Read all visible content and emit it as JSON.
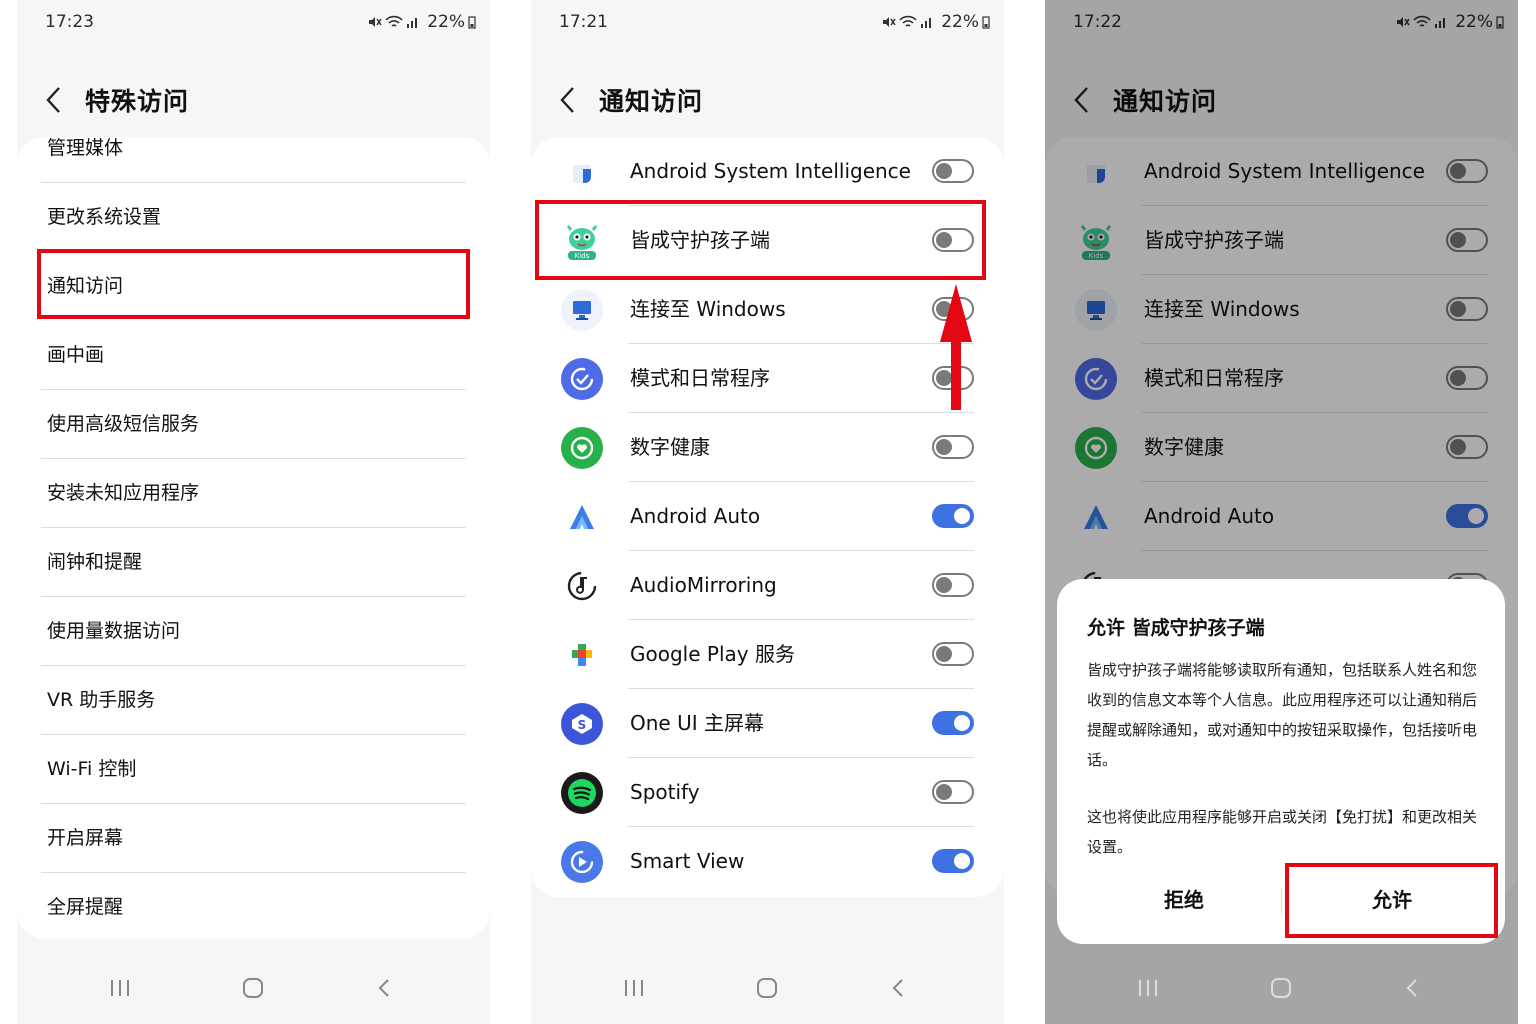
{
  "status": {
    "panel1_time": "17:23",
    "panel2_time": "17:21",
    "panel3_time": "17:22",
    "battery": "22%"
  },
  "panel1": {
    "title": "特殊访问",
    "items": [
      "管理媒体",
      "更改系统设置",
      "通知访问",
      "画中画",
      "使用高级短信服务",
      "安装未知应用程序",
      "闹钟和提醒",
      "使用量数据访问",
      "VR 助手服务",
      "Wi-Fi 控制",
      "开启屏幕",
      "全屏提醒"
    ]
  },
  "panel2": {
    "title": "通知访问",
    "apps": [
      {
        "label": "Android System Intelligence",
        "icon": "asi-icon",
        "enabled": false
      },
      {
        "label": "皆成守护孩子端",
        "icon": "kids-icon",
        "enabled": false
      },
      {
        "label": "连接至 Windows",
        "icon": "windows-link-icon",
        "enabled": false
      },
      {
        "label": "模式和日常程序",
        "icon": "modes-routines-icon",
        "enabled": false
      },
      {
        "label": "数字健康",
        "icon": "digital-wellbeing-icon",
        "enabled": false
      },
      {
        "label": "Android Auto",
        "icon": "android-auto-icon",
        "enabled": true
      },
      {
        "label": "AudioMirroring",
        "icon": "audio-mirroring-icon",
        "enabled": false
      },
      {
        "label": "Google Play 服务",
        "icon": "google-play-services-icon",
        "enabled": false
      },
      {
        "label": "One UI 主屏幕",
        "icon": "one-ui-home-icon",
        "enabled": true
      },
      {
        "label": "Spotify",
        "icon": "spotify-icon",
        "enabled": false
      },
      {
        "label": "Smart View",
        "icon": "smart-view-icon",
        "enabled": true
      }
    ]
  },
  "panel3": {
    "title": "通知访问",
    "dialog": {
      "title": "允许 皆成守护孩子端",
      "body1": "皆成守护孩子端将能够读取所有通知，包括联系人姓名和您收到的信息文本等个人信息。此应用程序还可以让通知稍后提醒或解除通知，或对通知中的按钮采取操作，包括接听电话。",
      "body2": "这也将使此应用程序能够开启或关闭【免打扰】和更改相关设置。",
      "deny": "拒绝",
      "allow": "允许"
    }
  },
  "colors": {
    "highlight": "#e30613",
    "toggle_on": "#3e72e3",
    "background": "#f6f6f8"
  }
}
